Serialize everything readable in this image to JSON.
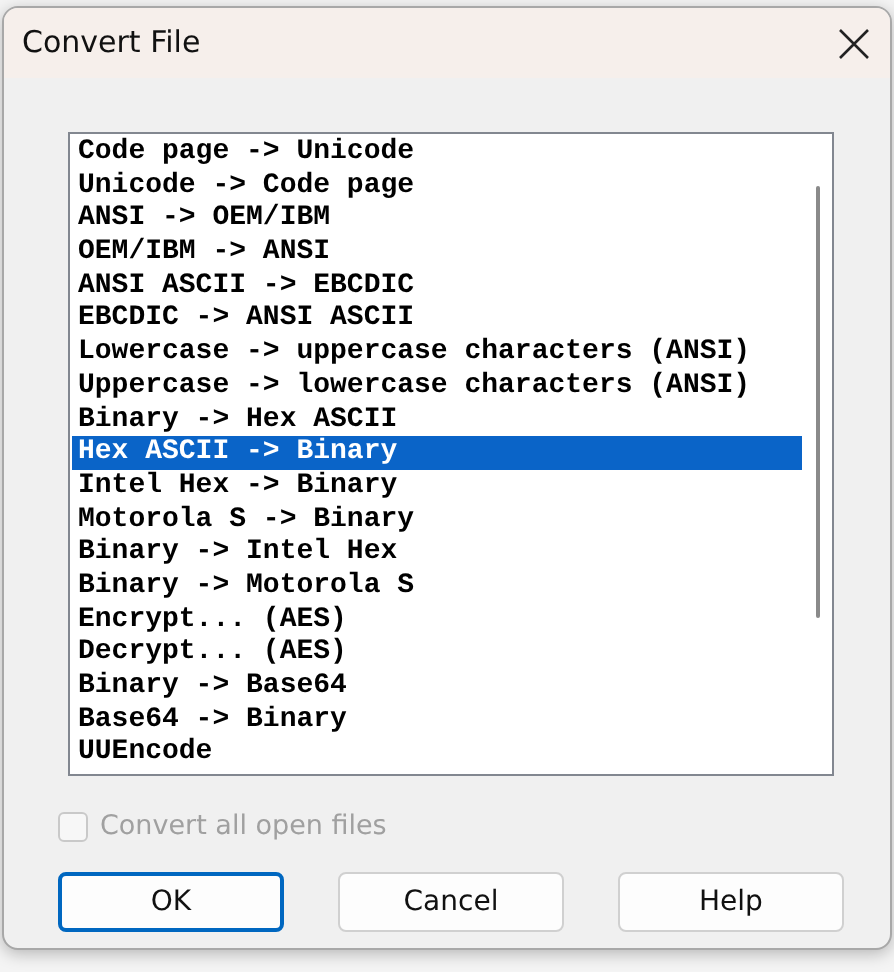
{
  "window": {
    "title": "Convert File"
  },
  "conversions": [
    {
      "label": "Code page -> Unicode",
      "selected": false
    },
    {
      "label": "Unicode -> Code page",
      "selected": false
    },
    {
      "label": "ANSI -> OEM/IBM",
      "selected": false
    },
    {
      "label": "OEM/IBM -> ANSI",
      "selected": false
    },
    {
      "label": "ANSI ASCII -> EBCDIC",
      "selected": false
    },
    {
      "label": "EBCDIC -> ANSI ASCII",
      "selected": false
    },
    {
      "label": "Lowercase -> uppercase characters (ANSI)",
      "selected": false
    },
    {
      "label": "Uppercase -> lowercase characters (ANSI)",
      "selected": false
    },
    {
      "label": "Binary -> Hex ASCII",
      "selected": false
    },
    {
      "label": "Hex ASCII -> Binary",
      "selected": true
    },
    {
      "label": "Intel Hex -> Binary",
      "selected": false
    },
    {
      "label": "Motorola S -> Binary",
      "selected": false
    },
    {
      "label": "Binary -> Intel Hex",
      "selected": false
    },
    {
      "label": "Binary -> Motorola S",
      "selected": false
    },
    {
      "label": "Encrypt... (AES)",
      "selected": false
    },
    {
      "label": "Decrypt... (AES)",
      "selected": false
    },
    {
      "label": "Binary -> Base64",
      "selected": false
    },
    {
      "label": "Base64 -> Binary",
      "selected": false
    },
    {
      "label": "UUEncode",
      "selected": false
    }
  ],
  "convert_all": {
    "label": "Convert all open files",
    "checked": false,
    "disabled": true
  },
  "buttons": [
    {
      "label": "OK",
      "default": true
    },
    {
      "label": "Cancel",
      "default": false
    },
    {
      "label": "Help",
      "default": false
    }
  ]
}
